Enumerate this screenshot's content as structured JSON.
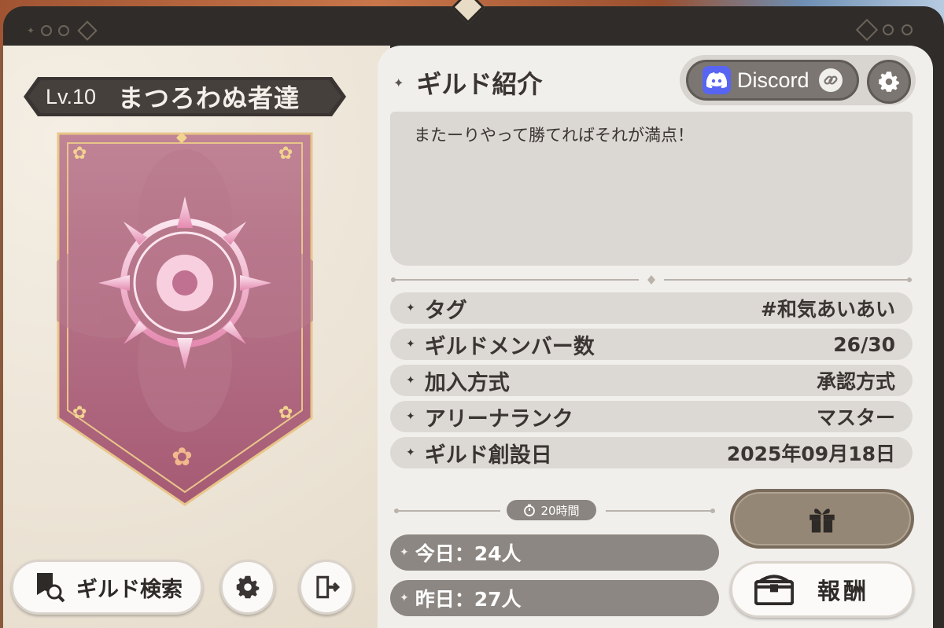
{
  "guild": {
    "level": "Lv.10",
    "name": "まつろわぬ者達"
  },
  "intro": {
    "title": "ギルド紹介",
    "description": "またーりやって勝てればそれが満点！"
  },
  "discord": {
    "label": "Discord",
    "icon": "discord-logo",
    "link_icon": "link-icon"
  },
  "info": [
    {
      "label": "タグ",
      "value": "#和気あいあい"
    },
    {
      "label": "ギルドメンバー数",
      "value": "26/30"
    },
    {
      "label": "加入方式",
      "value": "承認方式"
    },
    {
      "label": "アリーナランク",
      "value": "マスター"
    },
    {
      "label": "ギルド創設日",
      "value": "2025年09月18日"
    }
  ],
  "timer": {
    "label": "20時間"
  },
  "stats": {
    "today": "今日：24人",
    "yesterday": "昨日：27人"
  },
  "buttons": {
    "guild_search": "ギルド検索",
    "reward": "報酬"
  },
  "colors": {
    "banner": "#b06a82",
    "banner_border": "#e8c58a",
    "emblem": "#f4c6d8",
    "discord": "#5865f2"
  }
}
